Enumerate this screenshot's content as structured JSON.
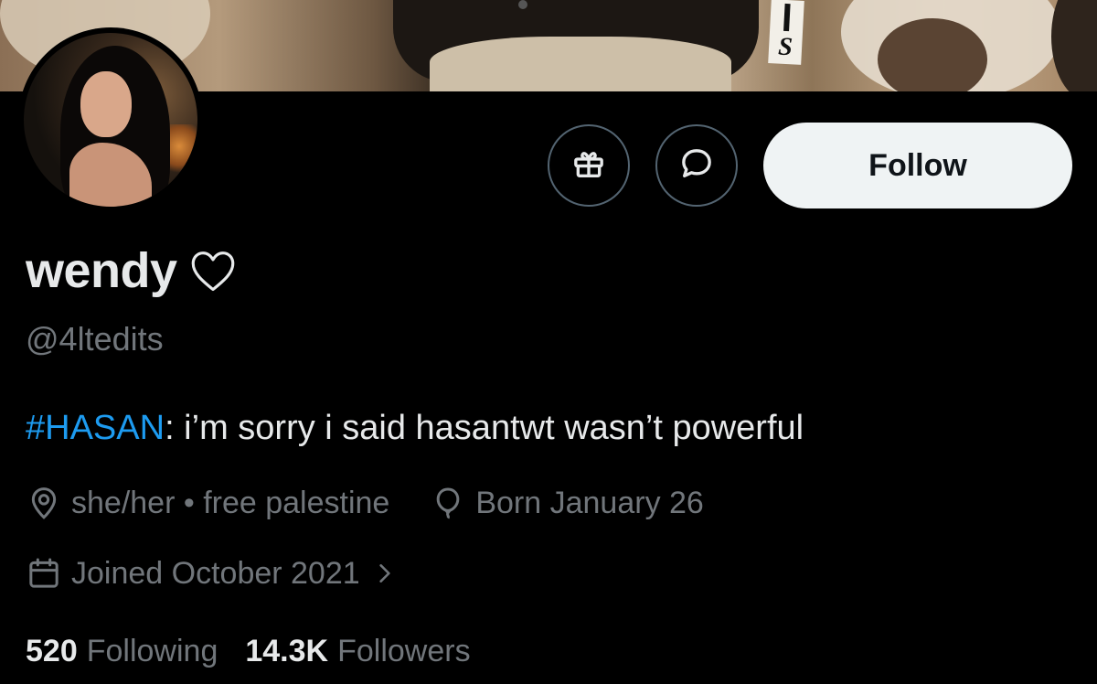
{
  "profile": {
    "display_name": "wendy",
    "handle": "@4ltedits",
    "bio_hashtag": "#HASAN",
    "bio_text": ": i’m sorry i said hasantwt wasn’t powerful",
    "location": "she/her • free palestine",
    "birthday": "Born January 26",
    "joined": "Joined October 2021",
    "banner_mark": "S"
  },
  "actions": {
    "follow_label": "Follow",
    "gift_icon": "gift-icon",
    "message_icon": "message-icon"
  },
  "stats": {
    "following_count": "520",
    "following_label": "Following",
    "followers_count": "14.3K",
    "followers_label": "Followers"
  },
  "colors": {
    "background": "#000000",
    "primary_text": "#e7e9ea",
    "secondary_text": "#71767b",
    "link": "#1d9bf0",
    "button_border": "#536471",
    "follow_bg": "#eff3f4"
  }
}
